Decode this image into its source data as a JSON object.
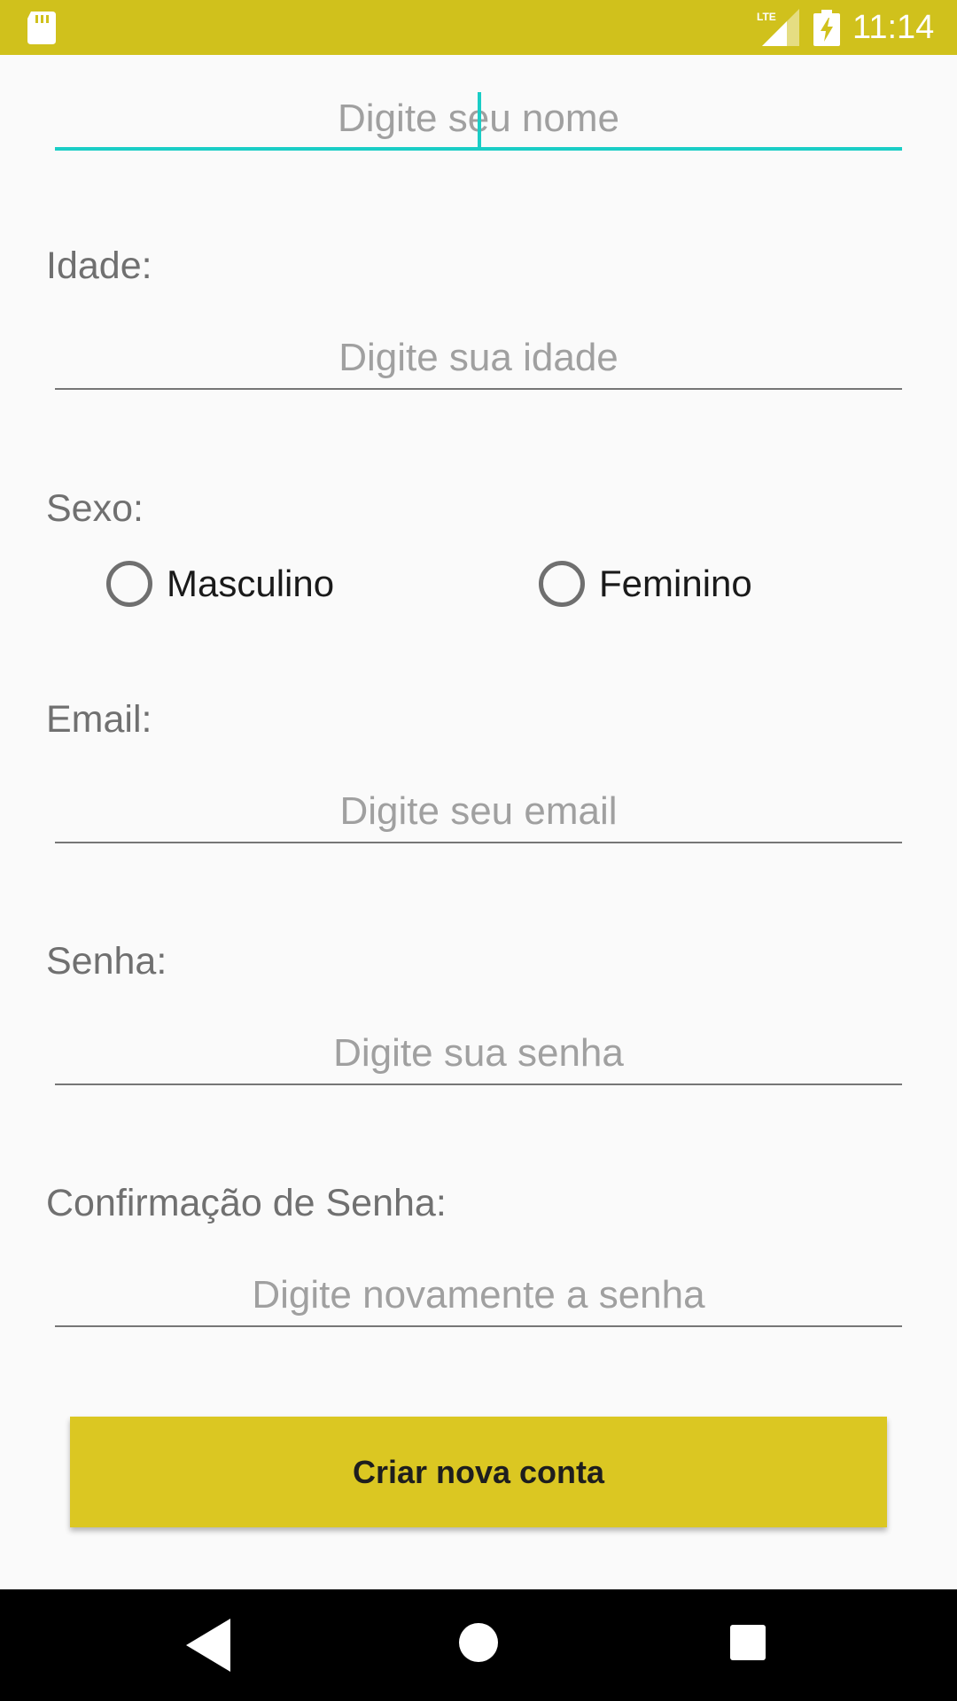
{
  "status_bar": {
    "time": "11:14",
    "network": "LTE",
    "icons": [
      "sd-card-icon",
      "signal-icon",
      "battery-charging-icon"
    ]
  },
  "form": {
    "name": {
      "placeholder": "Digite seu nome"
    },
    "age": {
      "label": "Idade:",
      "placeholder": "Digite sua idade"
    },
    "sex": {
      "label": "Sexo:",
      "options": [
        {
          "label": "Masculino",
          "selected": false
        },
        {
          "label": "Feminino",
          "selected": false
        }
      ]
    },
    "email": {
      "label": "Email:",
      "placeholder": "Digite seu email"
    },
    "password": {
      "label": "Senha:",
      "placeholder": "Digite sua senha"
    },
    "password_confirm": {
      "label": "Confirmação de Senha:",
      "placeholder": "Digite novamente a senha"
    },
    "submit_label": "Criar nova conta"
  },
  "nav_bar": {
    "icons": [
      "back-icon",
      "home-icon",
      "recents-icon"
    ]
  },
  "colors": {
    "status_bar": "#D0C11C",
    "accent": "#1ACDC6",
    "button": "#DBC722",
    "background": "#FAFAFA"
  }
}
